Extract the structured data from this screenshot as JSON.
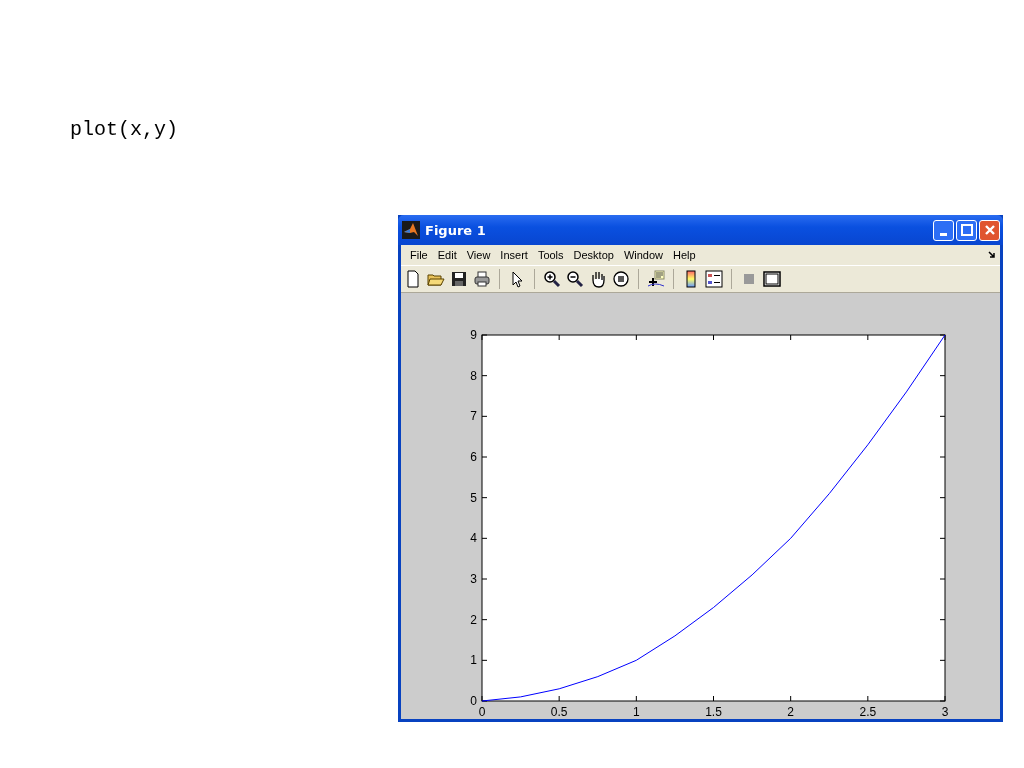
{
  "code_line": "plot(x,y)",
  "window": {
    "title": "Figure 1"
  },
  "menu": [
    "File",
    "Edit",
    "View",
    "Insert",
    "Tools",
    "Desktop",
    "Window",
    "Help"
  ],
  "toolbar": [
    {
      "kind": "new"
    },
    {
      "kind": "open"
    },
    {
      "kind": "save"
    },
    {
      "kind": "print"
    },
    {
      "kind": "sep"
    },
    {
      "kind": "pointer"
    },
    {
      "kind": "sep"
    },
    {
      "kind": "zoomin"
    },
    {
      "kind": "zoomout"
    },
    {
      "kind": "pan"
    },
    {
      "kind": "rotate"
    },
    {
      "kind": "sep"
    },
    {
      "kind": "datacursor"
    },
    {
      "kind": "sep"
    },
    {
      "kind": "colorbar"
    },
    {
      "kind": "legend"
    },
    {
      "kind": "sep"
    },
    {
      "kind": "hide"
    },
    {
      "kind": "show"
    }
  ],
  "chart_data": {
    "type": "line",
    "x": [
      0,
      0.25,
      0.5,
      0.75,
      1,
      1.25,
      1.5,
      1.75,
      2,
      2.25,
      2.5,
      2.75,
      3
    ],
    "series": [
      {
        "color": "#0000ff",
        "values": [
          0,
          0.1,
          0.3,
          0.6,
          1,
          1.6,
          2.3,
          3.1,
          4,
          5.1,
          6.3,
          7.6,
          9
        ]
      }
    ],
    "xlim": [
      0,
      3
    ],
    "ylim": [
      0,
      9
    ],
    "xticks": [
      0,
      {
        "value": 0.5,
        "label": "0.5"
      },
      1,
      {
        "value": 1.5,
        "label": "1.5"
      },
      2,
      {
        "value": 2.5,
        "label": "2.5"
      },
      3
    ],
    "yticks": [
      0,
      1,
      2,
      3,
      4,
      5,
      6,
      7,
      8,
      9
    ]
  }
}
